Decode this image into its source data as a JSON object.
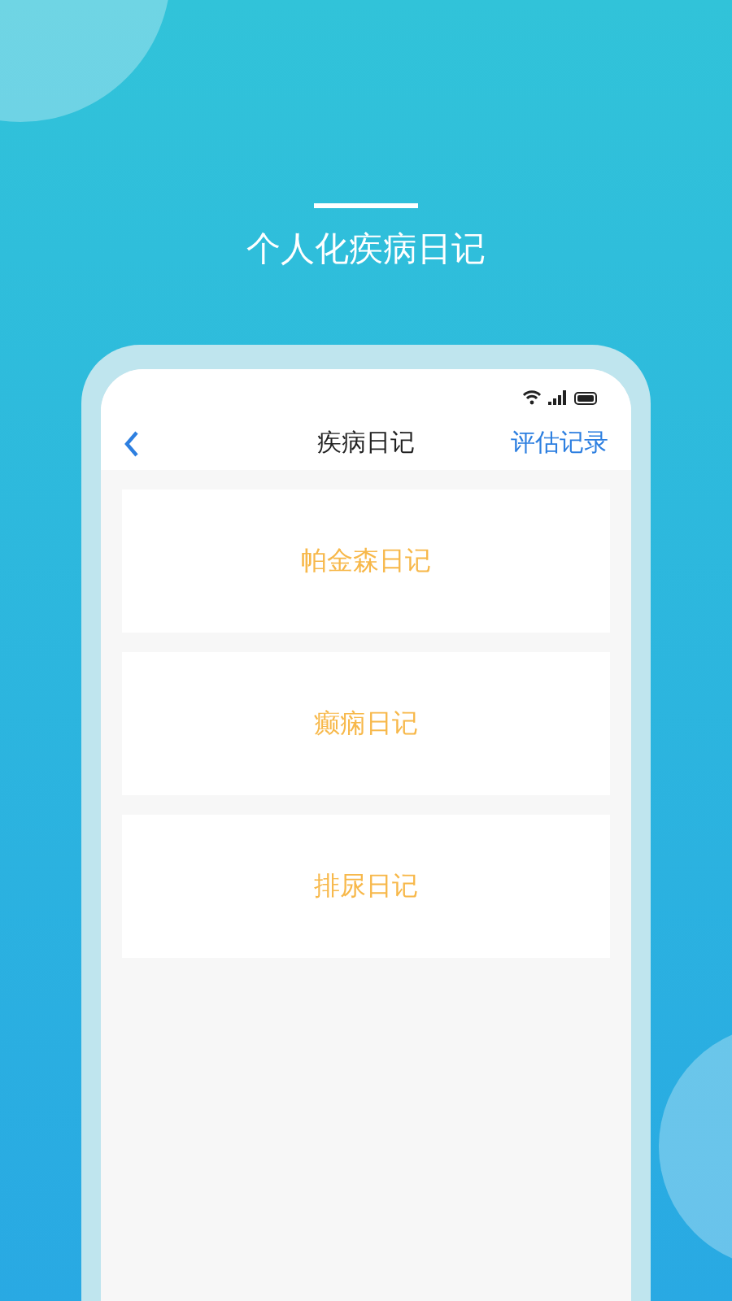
{
  "headline": "个人化疾病日记",
  "phone": {
    "title": "疾病日记",
    "action": "评估记录",
    "diaries": [
      {
        "label": "帕金森日记"
      },
      {
        "label": "癫痫日记"
      },
      {
        "label": "排尿日记"
      }
    ]
  }
}
